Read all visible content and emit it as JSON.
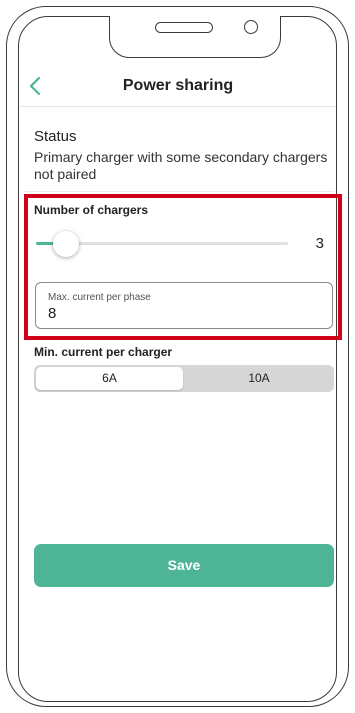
{
  "header": {
    "title": "Power sharing"
  },
  "status": {
    "title": "Status",
    "text": "Primary charger with some secondary chargers not paired"
  },
  "chargers": {
    "label": "Number of chargers",
    "value": "3",
    "slider_fraction": 0.12
  },
  "max_current": {
    "label": "Max. current per phase",
    "value": "8"
  },
  "min_current": {
    "label": "Min. current per charger",
    "options": [
      "6A",
      "10A"
    ],
    "selected": "6A"
  },
  "save_label": "Save",
  "colors": {
    "accent": "#4db595",
    "highlight": "#d0021b",
    "segment_bg": "#d6d6d6"
  },
  "icons": {
    "back": "chevron-left-icon"
  }
}
